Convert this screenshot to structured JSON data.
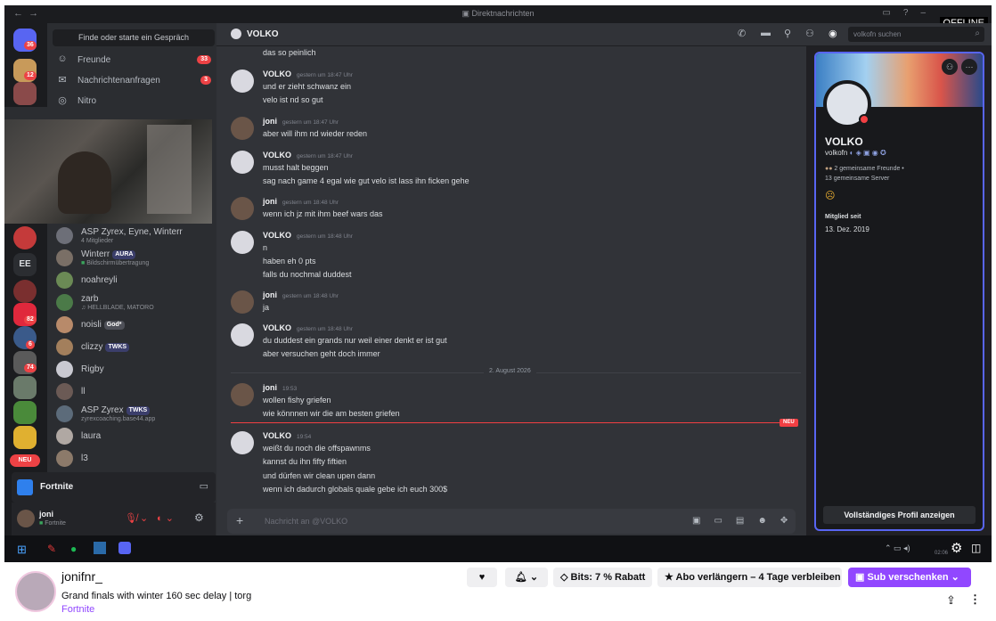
{
  "titlebar": {
    "title": "Direktnachrichten",
    "back": "←",
    "forward": "→",
    "offline_label": "OFFLINE"
  },
  "rail": {
    "badges": [
      "36",
      "12",
      "82",
      "6",
      "74"
    ],
    "ee_label": "EE",
    "new_label": "NEU"
  },
  "channels": {
    "search_placeholder": "Finde oder starte ein Gespräch",
    "nav": [
      {
        "label": "Freunde",
        "count": "33"
      },
      {
        "label": "Nachrichtenanfragen",
        "count": "3"
      },
      {
        "label": "Nitro",
        "count": ""
      }
    ],
    "dms": [
      {
        "name": "ASP Zyrex, Eyne, Winterr",
        "sub": "4 Mitglieder",
        "tag": "",
        "color": "#6d6f78"
      },
      {
        "name": "Winterr",
        "sub": "Bildschirmübertragung",
        "tag": "AURA",
        "color": "#7a6f66"
      },
      {
        "name": "noahreyli",
        "sub": "",
        "tag": "",
        "color": "#6b8a55"
      },
      {
        "name": "zarb",
        "sub": "HELLBLADE, MATORO",
        "tag": "",
        "color": "#4b7a48"
      },
      {
        "name": "noisli",
        "sub": "",
        "tag": "God*",
        "color": "#b88a6a"
      },
      {
        "name": "clizzy",
        "sub": "",
        "tag": "TWKS",
        "color": "#a37f5c"
      },
      {
        "name": "Rigby",
        "sub": "",
        "tag": "",
        "color": "#c9c9d1"
      },
      {
        "name": "ll",
        "sub": "",
        "tag": "",
        "color": "#6b5a55"
      },
      {
        "name": "ASP Zyrex",
        "sub": "zyrexcoaching.base44.app",
        "tag": "TWKS",
        "color": "#5c6b7a"
      },
      {
        "name": "laura",
        "sub": "",
        "tag": "",
        "color": "#b0a8a3"
      },
      {
        "name": "l3",
        "sub": "",
        "tag": "",
        "color": "#8c7a6a"
      }
    ],
    "game": "Fortnite",
    "user": {
      "name": "joni",
      "status": "Fortnite"
    }
  },
  "chat": {
    "recipient": "VOLKO",
    "search_placeholder": "volkofn suchen",
    "top_line": "das so peinlich",
    "messages": [
      {
        "author": "VOLKO",
        "time": "gestern um 18:47 Uhr",
        "lines": [
          "und er zieht schwanz ein",
          "velo ist nd so gut"
        ]
      },
      {
        "author": "joni",
        "time": "gestern um 18:47 Uhr",
        "lines": [
          "aber will ihm nd wieder reden"
        ]
      },
      {
        "author": "VOLKO",
        "time": "gestern um 18:47 Uhr",
        "lines": [
          "musst halt beggen",
          "sag nach game 4 egal wie gut velo ist lass ihn ficken gehe"
        ]
      },
      {
        "author": "joni",
        "time": "gestern um 18:48 Uhr",
        "lines": [
          "wenn ich jz mit ihm beef wars das"
        ]
      },
      {
        "author": "VOLKO",
        "time": "gestern um 18:48 Uhr",
        "lines": [
          "n",
          "haben eh 0 pts",
          "falls du nochmal duddest"
        ]
      },
      {
        "author": "joni",
        "time": "gestern um 18:48 Uhr",
        "lines": [
          "ja"
        ]
      },
      {
        "author": "VOLKO",
        "time": "gestern um 18:48 Uhr",
        "lines": [
          "du duddest ein grands nur weil einer denkt er ist gut",
          "aber versuchen geht doch immer"
        ]
      },
      {
        "author": "joni",
        "time": "19:53",
        "lines": [
          "wollen fishy griefen",
          "wie könnnen wir die am besten griefen"
        ]
      },
      {
        "author": "VOLKO",
        "time": "19:54",
        "lines": [
          "weißt du noch die offspawnms",
          "kannst du ihn fifty fiftien",
          "und dürfen wir clean upen dann",
          "wenn ich dadurch globals quale gebe ich euch 300$"
        ]
      }
    ],
    "date_divider": "2. August 2026",
    "new_label": "NEU",
    "input_placeholder": "Nachricht an @VOLKO"
  },
  "profile": {
    "display_name": "VOLKO",
    "username": "volkofn",
    "mutual_friends": "2 gemeinsame Freunde",
    "mutual_servers": "13 gemeinsame Server",
    "member_since_label": "Mitglied seit",
    "member_since": "13. Dez. 2019",
    "full_profile_button": "Vollständiges Profil anzeigen",
    "accent": "#5865f2"
  },
  "taskbar": {
    "clock": "02:06"
  },
  "twitch": {
    "channel": "jonifnr_",
    "title": "Grand finals with winter 160 sec delay | torg",
    "category": "Fortnite",
    "bits_label": "Bits: 7 % Rabatt",
    "renew_label": "Abo verlängern – 4 Tage verbleiben",
    "gift_label": "Sub verschenken",
    "accent": "#9147ff"
  }
}
